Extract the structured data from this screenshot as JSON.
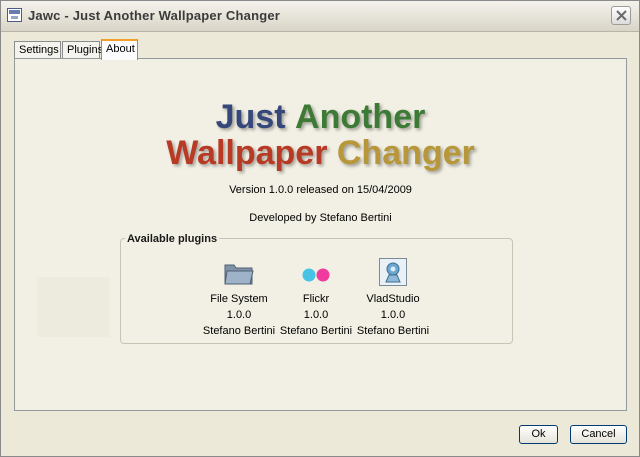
{
  "window": {
    "title": "Jawc - Just Another Wallpaper Changer"
  },
  "tabs": [
    {
      "label": "Settings"
    },
    {
      "label": "Plugins"
    },
    {
      "label": "About"
    }
  ],
  "about": {
    "logo": {
      "word1": "Just",
      "word2": "Another",
      "word3": "Wallpaper",
      "word4": "Changer"
    },
    "version": "Version 1.0.0 released on 15/04/2009",
    "developed": "Developed by Stefano Bertini",
    "group_title": "Available plugins",
    "plugins": [
      {
        "name": "File System",
        "version": "1.0.0",
        "author": "Stefano Bertini",
        "icon": "folder-icon"
      },
      {
        "name": "Flickr",
        "version": "1.0.0",
        "author": "Stefano Bertini",
        "icon": "flickr-icon"
      },
      {
        "name": "VladStudio",
        "version": "1.0.0",
        "author": "Stefano Bertini",
        "icon": "vladstudio-icon"
      }
    ]
  },
  "buttons": {
    "ok": "Ok",
    "cancel": "Cancel"
  },
  "colors": {
    "active_tab_accent": "#f1a02e",
    "button_border": "#003c74"
  }
}
